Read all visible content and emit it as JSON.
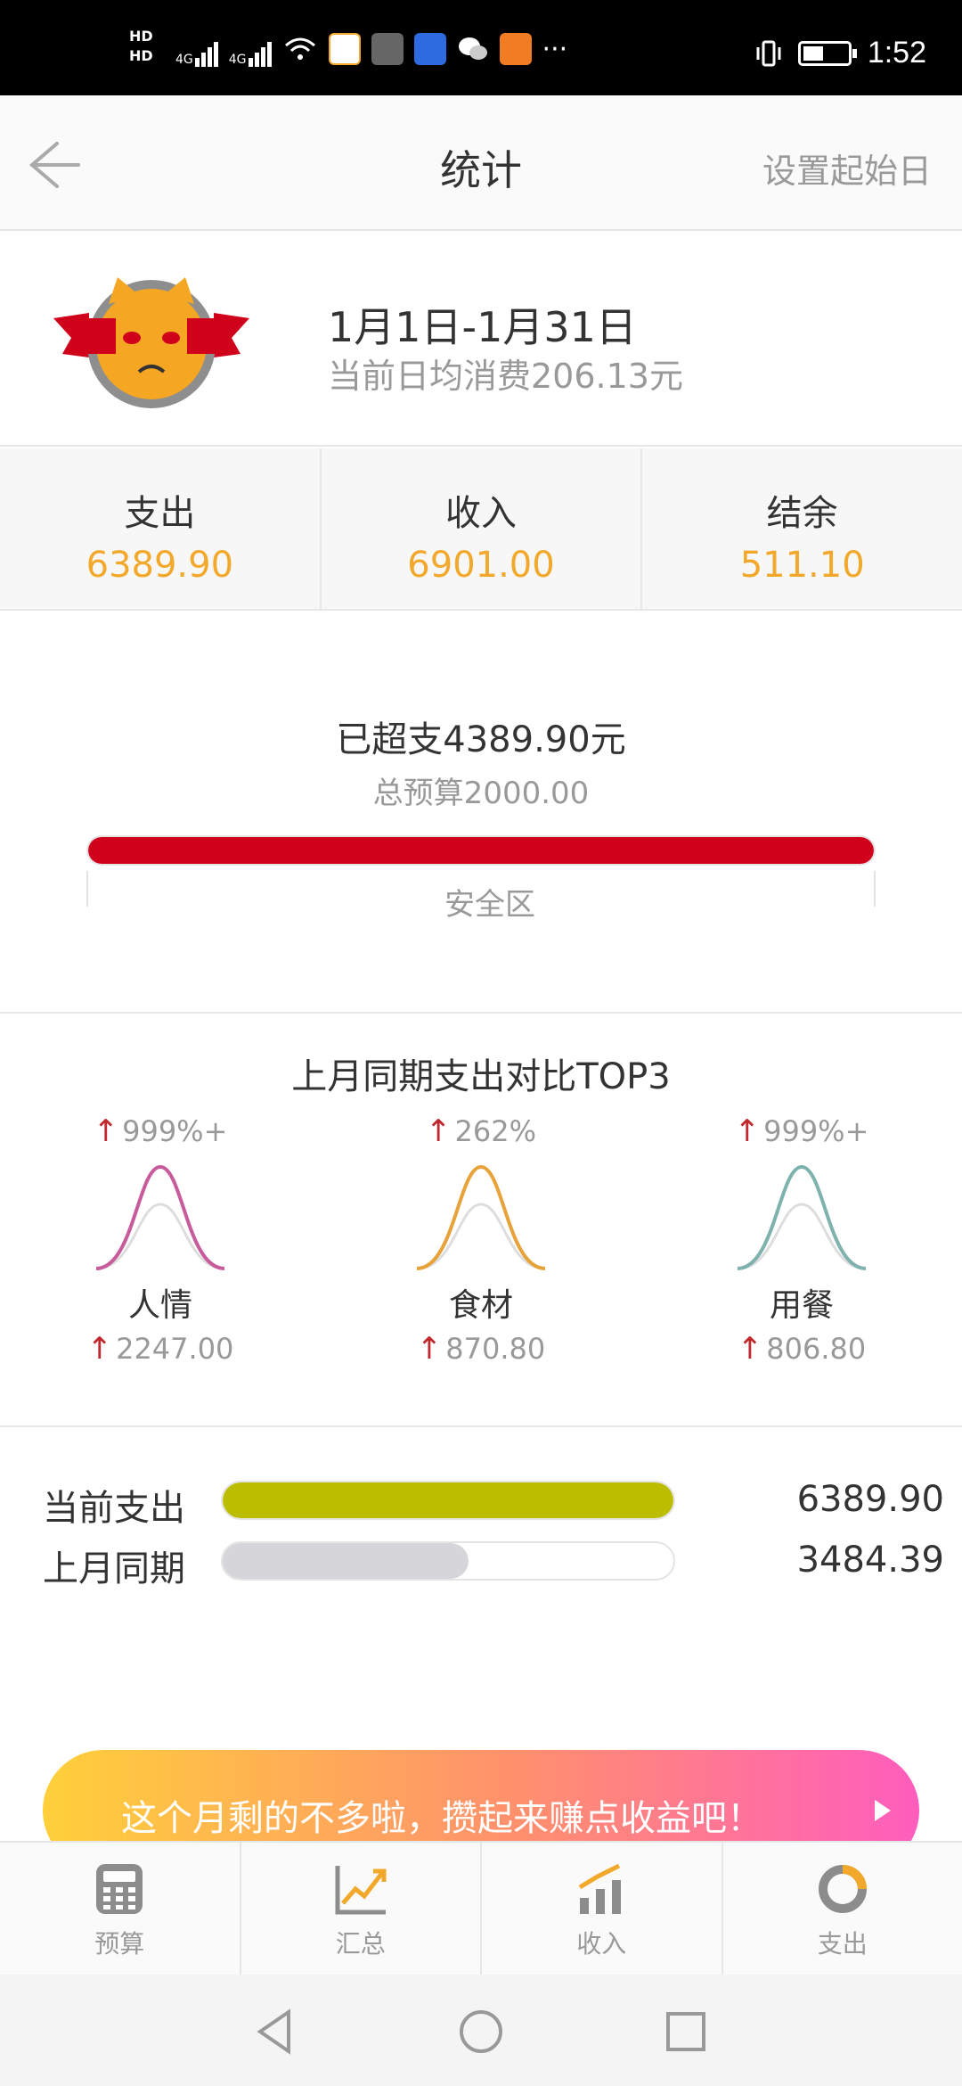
{
  "status_bar": {
    "time": "1:52",
    "network": "4G",
    "hd": [
      "HD",
      "HD"
    ]
  },
  "header": {
    "title": "统计",
    "action": "设置起始日"
  },
  "summary": {
    "date_range": "1月1日-1月31日",
    "daily_average": "当前日均消费206.13元"
  },
  "stats": [
    {
      "label": "支出",
      "value": "6389.90"
    },
    {
      "label": "收入",
      "value": "6901.00"
    },
    {
      "label": "结余",
      "value": "511.10"
    }
  ],
  "budget": {
    "overspent": "已超支4389.90元",
    "total": "总预算2000.00",
    "zone": "安全区",
    "fill_fraction": 1.0,
    "bar_color": "#d0021b"
  },
  "compare": {
    "title": "上月同期支出对比TOP3",
    "items": [
      {
        "pct": "999%+",
        "name": "人情",
        "value": "2247.00",
        "color": "#c75b9b"
      },
      {
        "pct": "262%",
        "name": "食材",
        "value": "870.80",
        "color": "#e8a23a"
      },
      {
        "pct": "999%+",
        "name": "用餐",
        "value": "806.80",
        "color": "#7fb2ae"
      }
    ],
    "arrow": "↑"
  },
  "period": {
    "current": {
      "label": "当前支出",
      "value": "6389.90",
      "fill_fraction": 1.0,
      "color": "#bcbc00"
    },
    "last": {
      "label": "上月同期",
      "value": "3484.39",
      "fill_fraction": 0.545,
      "color": "#d6d6da"
    }
  },
  "banner": {
    "text": "这个月剩的不多啦，攒起来赚点收益吧！"
  },
  "tabs": [
    {
      "label": "预算",
      "icon": "calculator-icon"
    },
    {
      "label": "汇总",
      "icon": "line-chart-icon"
    },
    {
      "label": "收入",
      "icon": "bar-chart-icon"
    },
    {
      "label": "支出",
      "icon": "donut-chart-icon"
    }
  ],
  "colors": {
    "accent": "#f2a82a",
    "danger": "#d0021b"
  }
}
